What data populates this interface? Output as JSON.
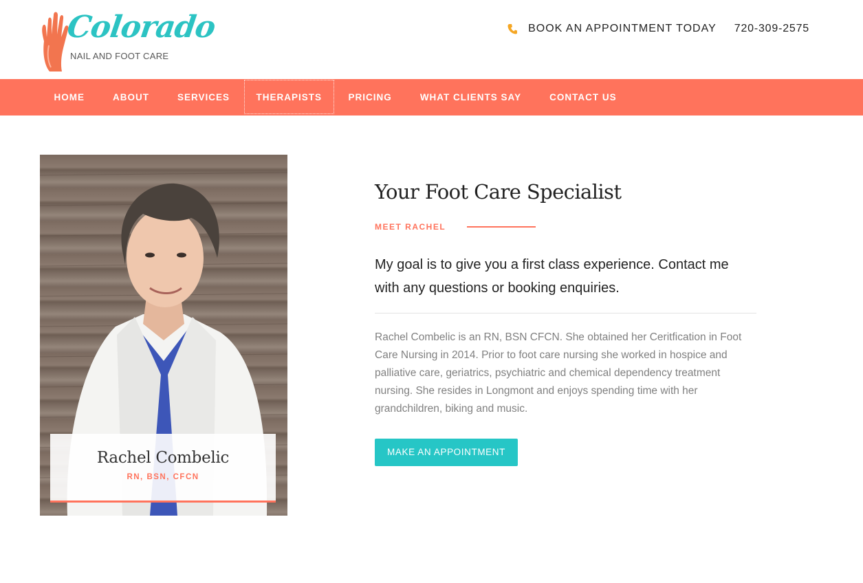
{
  "header": {
    "logo": {
      "brand": "Colorado",
      "subtitle": "NAIL AND FOOT CARE"
    },
    "phone_icon": "phone-icon",
    "book_text": "BOOK AN APPOINTMENT TODAY",
    "phone_number": "720-309-2575"
  },
  "nav": {
    "items": [
      {
        "label": "HOME"
      },
      {
        "label": "ABOUT"
      },
      {
        "label": "SERVICES"
      },
      {
        "label": "THERAPISTS",
        "active": true
      },
      {
        "label": "PRICING"
      },
      {
        "label": "WHAT CLIENTS SAY"
      },
      {
        "label": "CONTACT US"
      }
    ]
  },
  "profile": {
    "name": "Rachel Combelic",
    "credentials": "RN, BSN, CFCN"
  },
  "main": {
    "title": "Your Foot Care Specialist",
    "eyebrow": "MEET RACHEL",
    "lead": "My goal is to give you a first class experience. Contact me with any questions or booking enquiries.",
    "bio": "Rachel Combelic is an RN, BSN CFCN. She obtained her Ceritfication in Foot Care Nursing in 2014. Prior to foot care nursing she worked in hospice and palliative care, geriatrics, psychiatric and chemical dependency treatment nursing. She resides in Longmont and enjoys spending time with her grandchildren, biking and music.",
    "cta_label": "MAKE AN APPOINTMENT"
  },
  "colors": {
    "accent": "#ff735c",
    "teal": "#26c6c6",
    "body_text": "#808080"
  }
}
